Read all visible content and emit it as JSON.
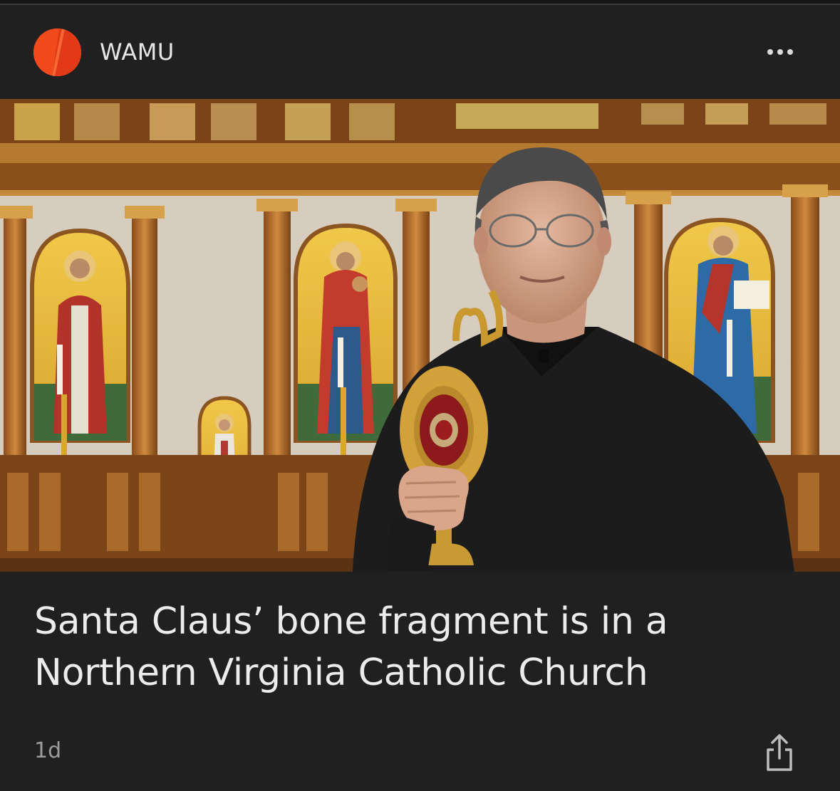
{
  "source": {
    "name": "WAMU",
    "logo_icon": "wamu-logo-icon",
    "logo_color": "#f04a1d"
  },
  "menu": {
    "icon": "more-horizontal-icon"
  },
  "article": {
    "headline": "Santa Claus’ bone fragment is in a Northern Virginia Catholic Church",
    "age": "1d",
    "image_icon": "article-photo"
  },
  "actions": {
    "share_icon": "share-icon"
  },
  "colors": {
    "background": "#202021",
    "headline_text": "#ececec",
    "meta_text": "#9c9c9c"
  }
}
